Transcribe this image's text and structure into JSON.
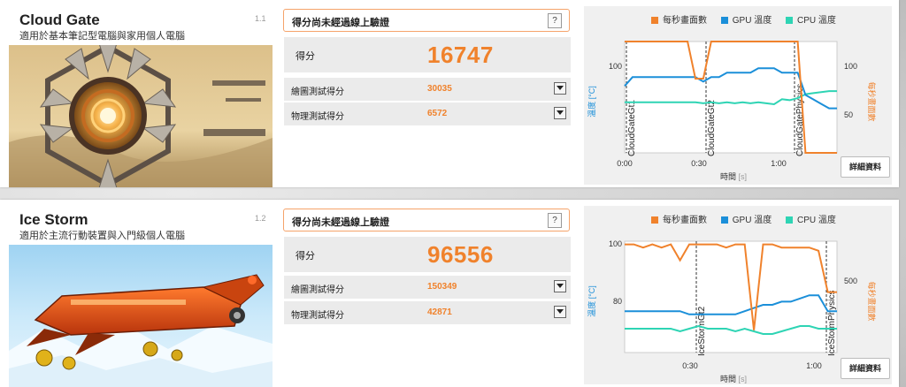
{
  "colors": {
    "fps": "#f0822c",
    "gpu": "#1b8fd9",
    "cpu": "#2ed4b4",
    "accent": "#f0822c"
  },
  "legend": {
    "fps": "每秒畫面數",
    "gpu": "GPU 溫度",
    "cpu": "CPU 溫度"
  },
  "tests": [
    {
      "name": "Cloud Gate",
      "description": "適用於基本筆記型電腦與家用個人電腦",
      "version": "1.1",
      "status": "得分尚未經過線上驗證",
      "help_label": "?",
      "score_label": "得分",
      "score": "16747",
      "graphics_label": "繪圖測試得分",
      "graphics_score": "30035",
      "physics_label": "物理測試得分",
      "physics_score": "6572",
      "details_label": "詳細資料",
      "xaxis_label": "時間",
      "xaxis_unit": "[s]",
      "left_axis_label": "溫度 [°C]",
      "right_axis_label": "每秒畫面數",
      "chart_data": {
        "type": "line",
        "x_ticks": [
          "0:00",
          "0:30",
          "1:00"
        ],
        "left_ticks": [
          "100"
        ],
        "right_ticks": [
          "100",
          "50"
        ],
        "segments": [
          "CloudGateGt1",
          "CloudGateGt2",
          "CloudGatePhysics"
        ],
        "series": [
          {
            "key": "fps",
            "values": [
              100,
              98,
              85,
              100,
              90,
              100,
              70,
              100,
              90,
              60,
              60,
              95,
              100,
              95,
              100,
              100,
              98,
              100,
              100,
              99,
              100,
              98,
              100,
              20,
              18,
              17,
              17,
              17
            ]
          },
          {
            "key": "gpu",
            "values": [
              60,
              62,
              62,
              62,
              62,
              62,
              62,
              62,
              62,
              62,
              61,
              62,
              62,
              63,
              63,
              63,
              63,
              64,
              64,
              64,
              63,
              63,
              63,
              58,
              57,
              56,
              55,
              55
            ]
          },
          {
            "key": "cpu",
            "values": [
              50,
              50,
              50,
              50,
              50,
              50,
              50,
              50,
              50,
              50,
              49,
              50,
              49,
              50,
              49,
              50,
              49,
              50,
              49,
              48,
              53,
              52,
              54,
              58,
              59,
              60,
              61,
              61
            ]
          }
        ]
      }
    },
    {
      "name": "Ice Storm",
      "description": "適用於主流行動裝置與入門級個人電腦",
      "version": "1.2",
      "status": "得分尚未經過線上驗證",
      "help_label": "?",
      "score_label": "得分",
      "score": "96556",
      "graphics_label": "繪圖測試得分",
      "graphics_score": "150349",
      "physics_label": "物理測試得分",
      "physics_score": "42871",
      "details_label": "詳細資料",
      "xaxis_label": "時間",
      "xaxis_unit": "[s]",
      "left_axis_label": "溫度 [°C]",
      "right_axis_label": "每秒畫面數",
      "chart_data": {
        "type": "line",
        "x_ticks": [
          "0:30",
          "1:00"
        ],
        "left_ticks": [
          "100",
          "80"
        ],
        "right_ticks": [
          "500"
        ],
        "segments": [
          "IceStormGt2",
          "IceStormPhysics"
        ],
        "series": [
          {
            "key": "fps",
            "values": [
              99,
              99,
              98,
              99,
              98,
              99,
              94,
              99,
              99,
              99,
              99,
              98,
              99,
              99,
              72,
              99,
              99,
              98,
              98,
              98,
              98,
              97,
              84,
              84
            ]
          },
          {
            "key": "gpu",
            "values": [
              78,
              78,
              78,
              78,
              78,
              78,
              78,
              77,
              77,
              77,
              77,
              77,
              77,
              78,
              79,
              80,
              80,
              81,
              81,
              82,
              83,
              83,
              78,
              78
            ]
          },
          {
            "key": "cpu",
            "values": [
              69,
              69,
              69,
              69,
              69,
              69,
              68,
              69,
              70,
              69,
              69,
              69,
              68,
              69,
              68,
              67,
              67,
              68,
              69,
              70,
              70,
              69,
              69,
              69
            ]
          }
        ]
      }
    }
  ]
}
